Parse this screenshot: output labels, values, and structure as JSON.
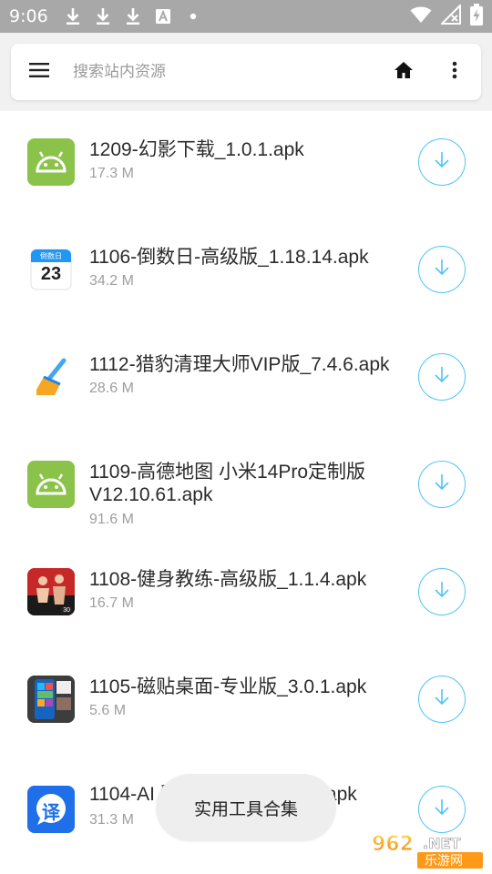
{
  "status_bar": {
    "time": "9:06",
    "colors": {
      "background": "#a8a8a8",
      "foreground": "#ffffff"
    },
    "icons": [
      "download-icon",
      "download-icon",
      "download-icon",
      "text-a-icon",
      "dot-icon",
      "wifi-icon",
      "no-signal-icon",
      "battery-charging-icon"
    ]
  },
  "search": {
    "placeholder": "搜索站内资源",
    "menu_icon": "menu-icon",
    "home_icon": "home-icon",
    "more_icon": "more-vert-icon"
  },
  "files": [
    {
      "name": "1209-幻影下载_1.0.1.apk",
      "size": "17.3 M",
      "icon": "android-icon"
    },
    {
      "name": "1106-倒数日-高级版_1.18.14.apk",
      "size": "34.2 M",
      "icon": "countdown-icon",
      "icon_text": "倒数日",
      "icon_number": "23"
    },
    {
      "name": "1112-猎豹清理大师VIP版_7.4.6.apk",
      "size": "28.6 M",
      "icon": "broom-icon"
    },
    {
      "name": "1109-高德地图 小米14Pro定制版V12.10.61.apk",
      "size": "91.6 M",
      "icon": "android-icon"
    },
    {
      "name": "1108-健身教练-高级版_1.1.4.apk",
      "size": "16.7 M",
      "icon": "fitness-icon",
      "icon_badge": "30"
    },
    {
      "name": "1105-磁贴桌面-专业版_3.0.1.apk",
      "size": "5.6 M",
      "icon": "tiles-icon"
    },
    {
      "name": "1104-AI 翻译通VIP版_1.0.9.apk",
      "size": "31.3 M",
      "icon": "translate-icon",
      "icon_text": "译"
    }
  ],
  "download_icon": "download-circle-icon",
  "toast": {
    "text": "实用工具合集"
  },
  "watermark": {
    "text_top": "962.NET",
    "text_bottom": "乐游网"
  },
  "colors": {
    "accent": "#4fc3f7",
    "android_green": "#8bc34a",
    "toolbar_bg": "#f1f1f1"
  }
}
